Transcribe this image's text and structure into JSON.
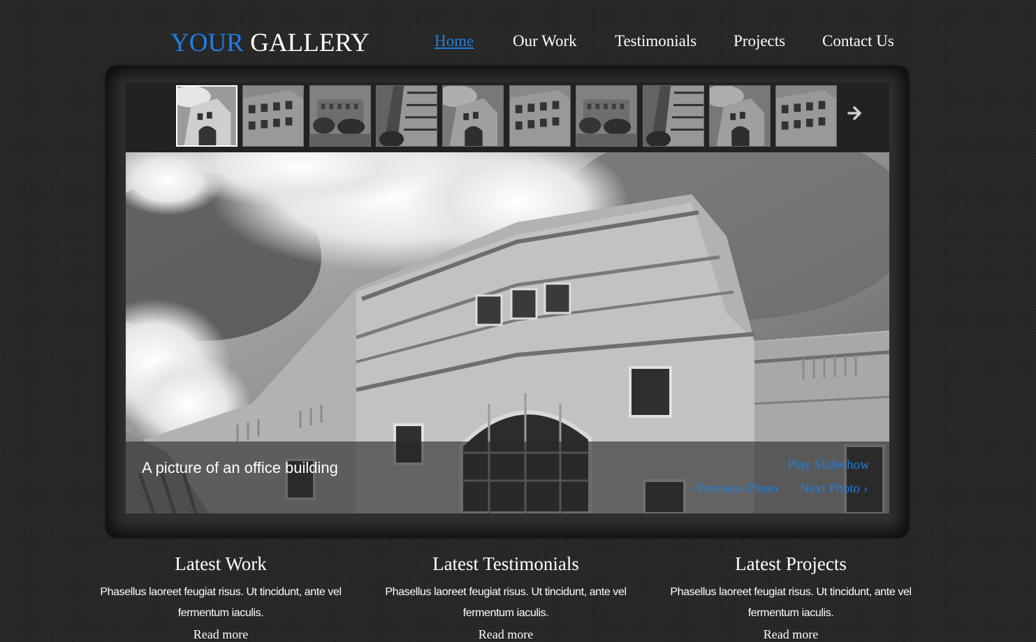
{
  "header": {
    "logo_accent": "YOUR",
    "logo_main": " GALLERY",
    "nav": [
      {
        "label": "Home",
        "active": true
      },
      {
        "label": "Our Work"
      },
      {
        "label": "Testimonials"
      },
      {
        "label": "Projects"
      },
      {
        "label": "Contact Us"
      }
    ]
  },
  "gallery": {
    "thumbnails": [
      {
        "subject": "office-building-arch"
      },
      {
        "subject": "office-building-side"
      },
      {
        "subject": "office-building-trees"
      },
      {
        "subject": "office-tower-corner"
      },
      {
        "subject": "office-building-arch"
      },
      {
        "subject": "office-building-side"
      },
      {
        "subject": "office-building-trees"
      },
      {
        "subject": "office-tower-corner"
      },
      {
        "subject": "office-building-arch"
      },
      {
        "subject": "office-building-side"
      }
    ],
    "active_thumbnail": 1,
    "next_icon": "arrow-right-icon",
    "caption": "A picture of an office building",
    "play_slideshow": "Play Slideshow",
    "previous_photo": "‹ Previous Photo",
    "next_photo": "Next Photo ›"
  },
  "columns": [
    {
      "title": "Latest Work",
      "text": "Phasellus laoreet feugiat risus. Ut tincidunt, ante vel fermentum iaculis.",
      "more": "Read more"
    },
    {
      "title": "Latest Testimonials",
      "text": "Phasellus laoreet feugiat risus. Ut tincidunt, ante vel fermentum iaculis.",
      "more": "Read more"
    },
    {
      "title": "Latest Projects",
      "text": "Phasellus laoreet feugiat risus. Ut tincidunt, ante vel fermentum iaculis.",
      "more": "Read more"
    }
  ],
  "colors": {
    "accent": "#1e7fe0",
    "background": "#2a2a2a",
    "panel": "#303030"
  }
}
